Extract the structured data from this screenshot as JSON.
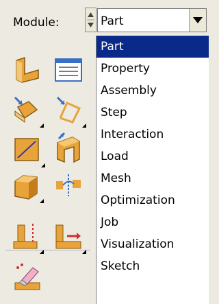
{
  "module": {
    "label": "Module:",
    "selected": "Part"
  },
  "menu": {
    "items": [
      {
        "label": "Part",
        "selected": true
      },
      {
        "label": "Property",
        "selected": false
      },
      {
        "label": "Assembly",
        "selected": false
      },
      {
        "label": "Step",
        "selected": false
      },
      {
        "label": "Interaction",
        "selected": false
      },
      {
        "label": "Load",
        "selected": false
      },
      {
        "label": "Mesh",
        "selected": false
      },
      {
        "label": "Optimization",
        "selected": false
      },
      {
        "label": "Job",
        "selected": false
      },
      {
        "label": "Visualization",
        "selected": false
      },
      {
        "label": "Sketch",
        "selected": false
      }
    ]
  },
  "toolbox": {
    "icons": [
      "create-part-icon",
      "part-manager-icon",
      "partition-face-icon",
      "partition-edge-icon",
      "create-datum-plane-icon",
      "create-solid-extrude-icon",
      "create-cut-icon",
      "create-datum-axis-icon",
      "create-datum-point-icon",
      "create-datum-csys-icon",
      "sketch-eraser-icon"
    ]
  },
  "colors": {
    "highlight": "#0a2a8a",
    "panel": "#eceae1",
    "icon_orange": "#e8a33a",
    "icon_blue": "#3a6fc7"
  }
}
